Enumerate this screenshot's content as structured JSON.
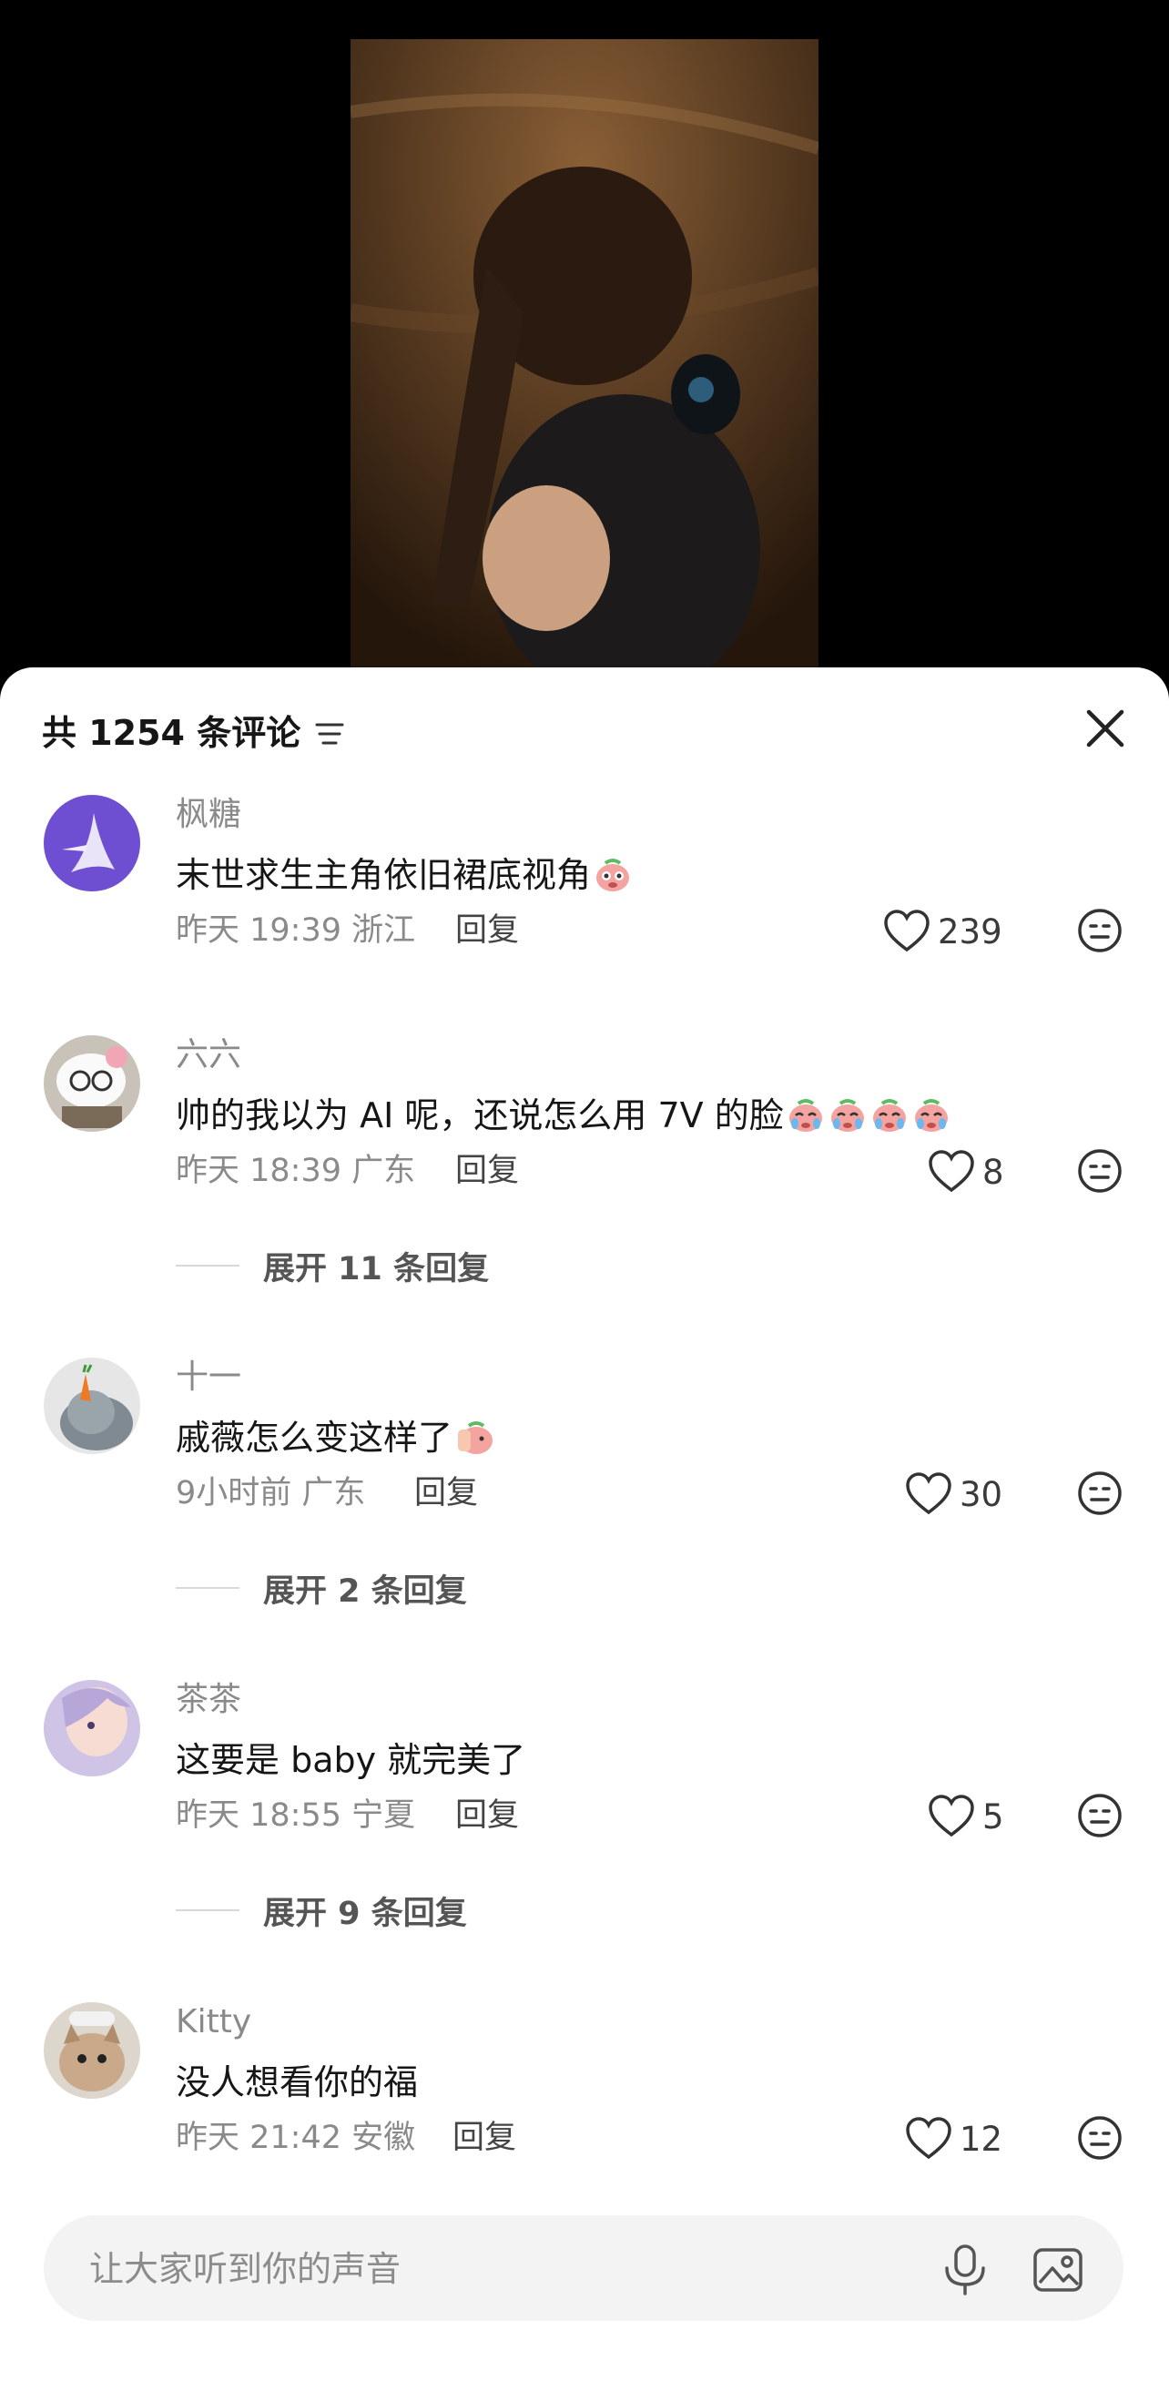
{
  "video": {
    "description_icon": "video-player"
  },
  "header": {
    "title": "共 1254 条评论",
    "sort_icon": "sort-icon",
    "close_icon": "close-icon"
  },
  "comments": [
    {
      "username": "枫糖",
      "text": "末世求生主角依旧裙底视角",
      "emojis": 1,
      "time": "昨天 19:39",
      "location": "浙江",
      "reply": "回复",
      "likes": "239",
      "expand": ""
    },
    {
      "username": "六六",
      "text": "帅的我以为 AI 呢，还说怎么用 7V 的脸",
      "emojis": 4,
      "time": "昨天 18:39",
      "location": "广东",
      "reply": "回复",
      "likes": "8",
      "expand": "展开 11 条回复"
    },
    {
      "username": "十一",
      "text": "戚薇怎么变这样了",
      "emojis": 1,
      "time": "9小时前",
      "location": "广东",
      "reply": "回复",
      "likes": "30",
      "expand": "展开 2 条回复"
    },
    {
      "username": "茶茶",
      "text": "这要是 baby 就完美了",
      "emojis": 0,
      "time": "昨天 18:55",
      "location": "宁夏",
      "reply": "回复",
      "likes": "5",
      "expand": "展开 9 条回复"
    },
    {
      "username": "Kitty",
      "text": "没人想看你的福",
      "emojis": 0,
      "time": "昨天 21:42",
      "location": "安徽",
      "reply": "回复",
      "likes": "12",
      "expand": ""
    }
  ],
  "input": {
    "placeholder": "让大家听到你的声音"
  },
  "colors": {
    "accent_text": "#161616",
    "muted_text": "#8a8a8a",
    "input_bg": "#f3f3f3"
  }
}
